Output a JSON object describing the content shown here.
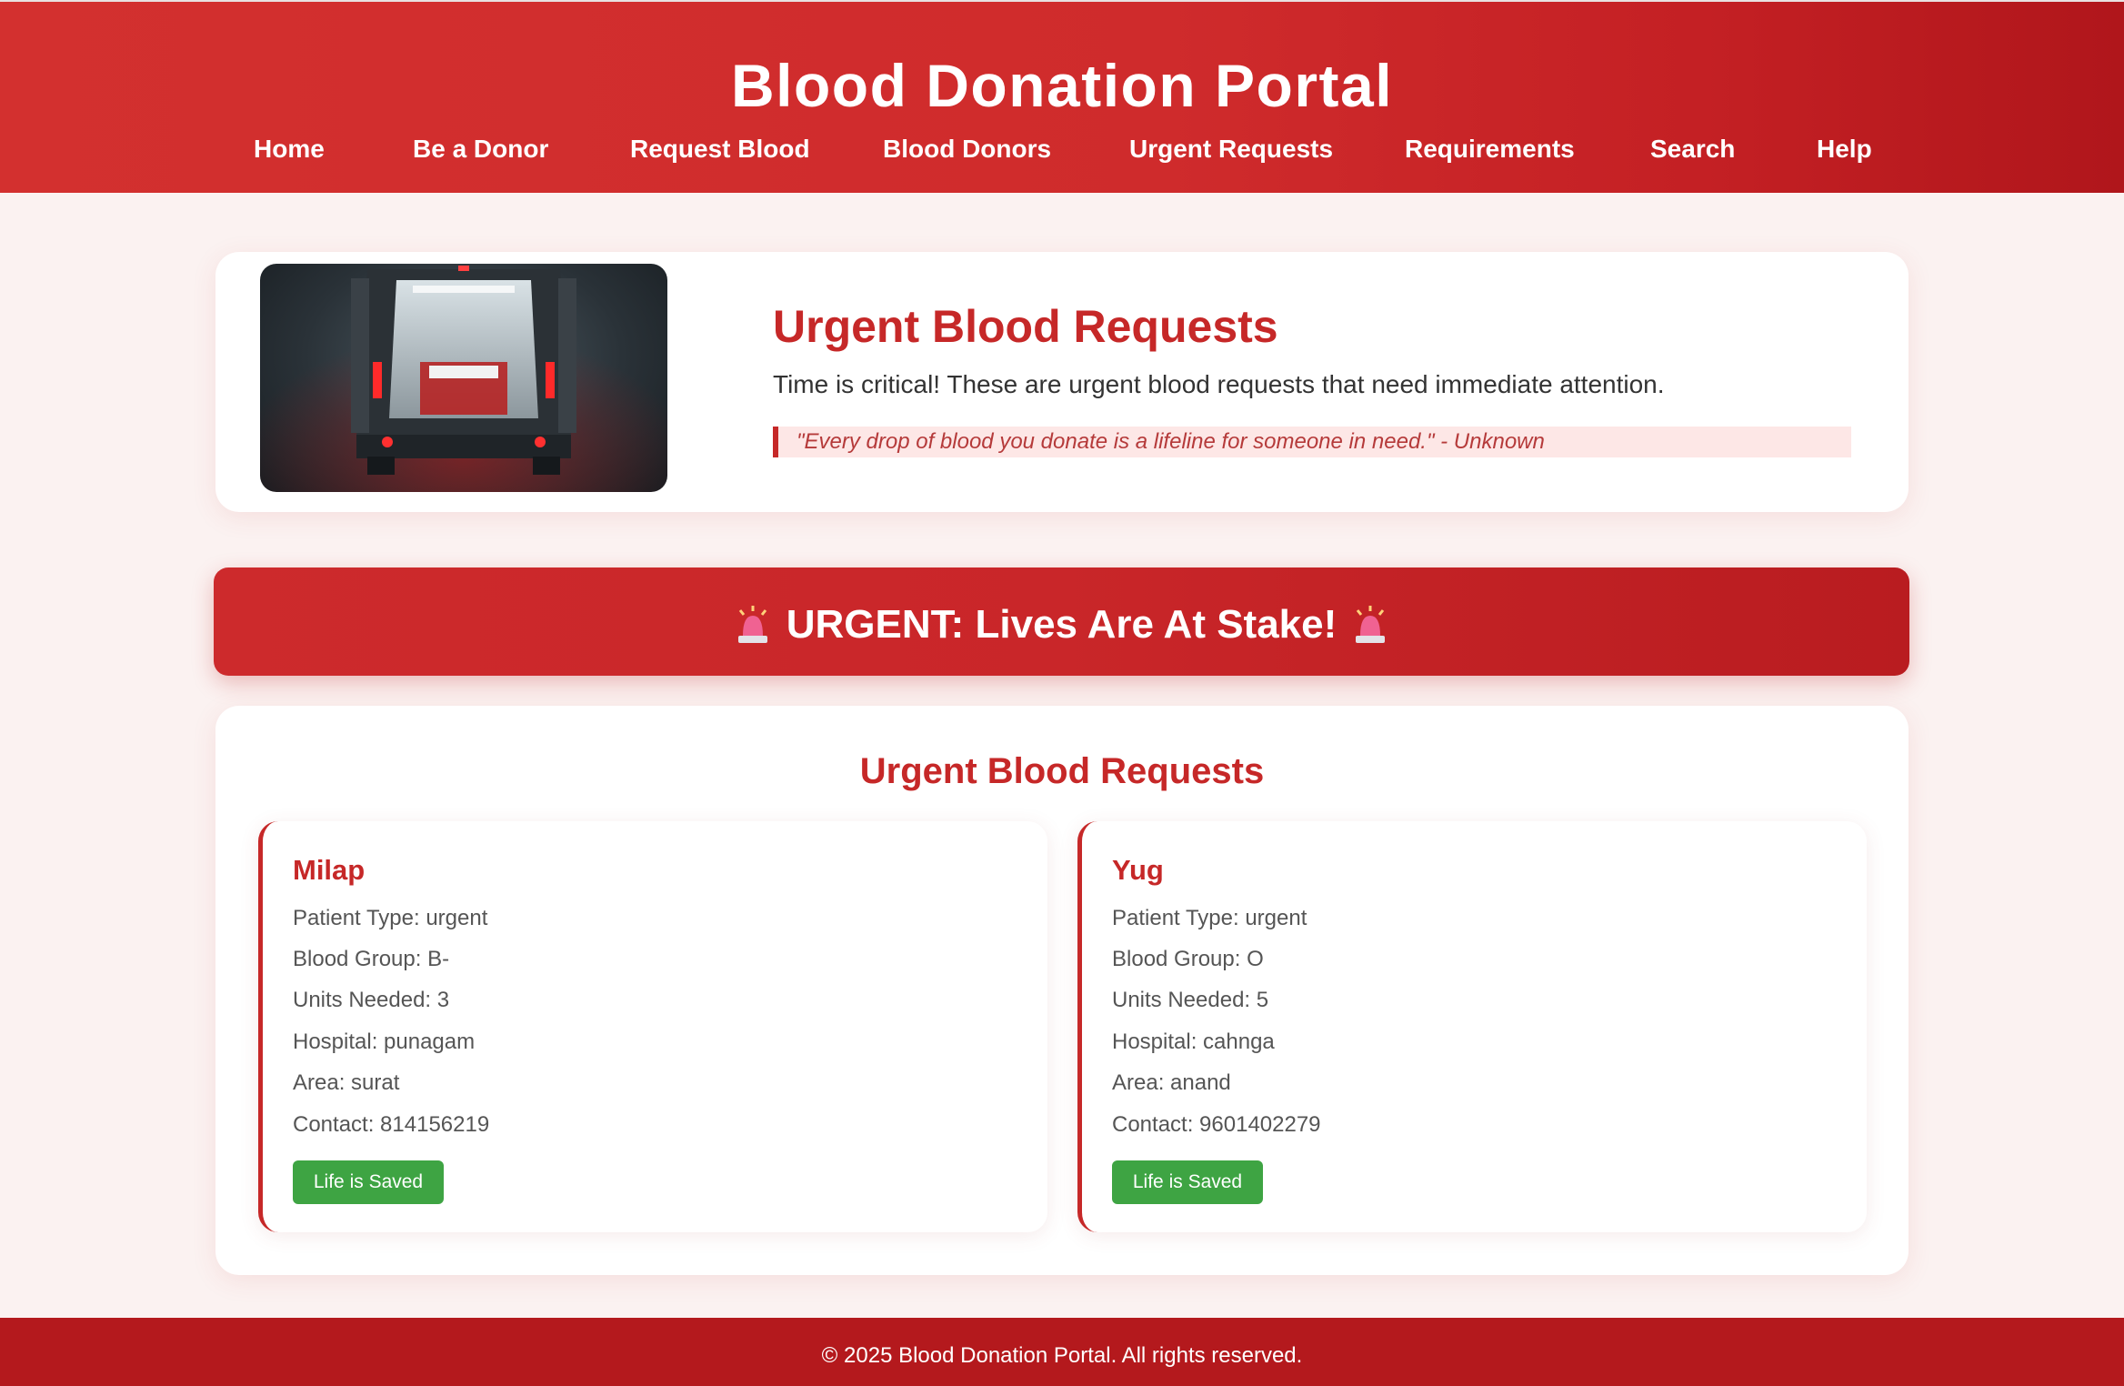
{
  "header": {
    "title": "Blood Donation Portal",
    "nav": [
      "Home",
      "Be a Donor",
      "Request Blood",
      "Blood Donors",
      "Urgent Requests",
      "Requirements",
      "Search",
      "Help"
    ]
  },
  "hero": {
    "heading": "Urgent Blood Requests",
    "text": "Time is critical! These are urgent blood requests that need immediate attention.",
    "quote": "\"Every drop of blood you donate is a lifeline for someone in need.\" - Unknown"
  },
  "banner": {
    "text": "URGENT: Lives Are At Stake!",
    "icon": "siren-icon"
  },
  "requests": {
    "title": "Urgent Blood Requests",
    "cards": [
      {
        "name": "Milap",
        "patient_type": "Patient Type: urgent",
        "blood_group": "Blood Group: B-",
        "units": "Units Needed: 3",
        "hospital": "Hospital: punagam",
        "area": "Area: surat",
        "contact": "Contact: 814156219",
        "button": "Life is Saved"
      },
      {
        "name": "Yug",
        "patient_type": "Patient Type: urgent",
        "blood_group": "Blood Group: O",
        "units": "Units Needed: 5",
        "hospital": "Hospital: cahnga",
        "area": "Area: anand",
        "contact": "Contact: 9601402279",
        "button": "Life is Saved"
      }
    ]
  },
  "footer": {
    "text": "© 2025 Blood Donation Portal. All rights reserved."
  },
  "colors": {
    "brand_red": "#c62828",
    "header_red": "#d3302f",
    "success_green": "#3ea443",
    "page_background": "#fbf2f1"
  }
}
